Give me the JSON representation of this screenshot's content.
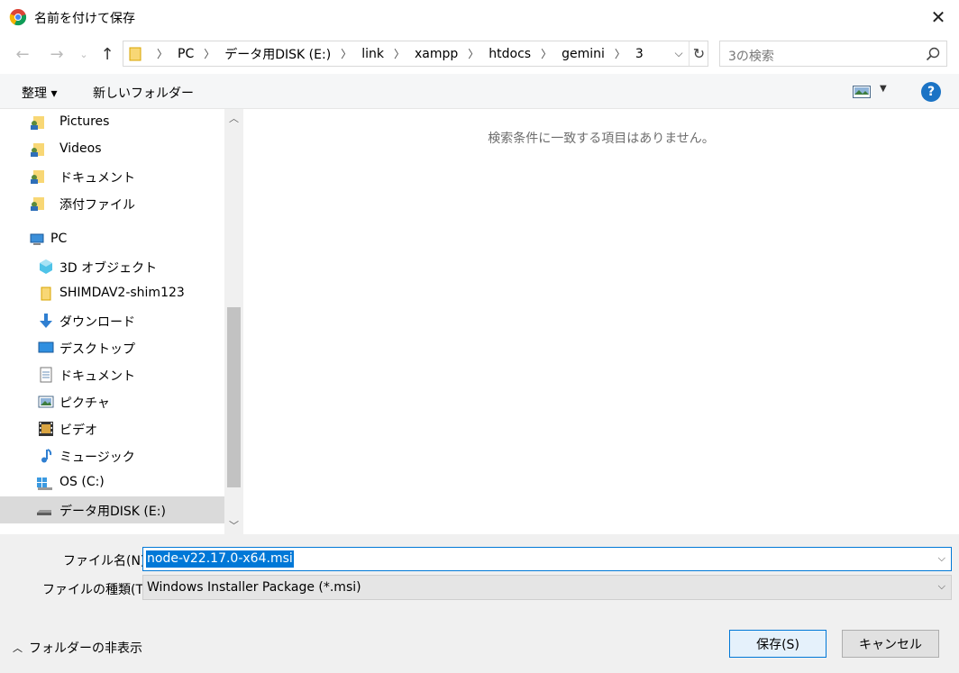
{
  "window": {
    "title": "名前を付けて保存"
  },
  "nav": {
    "breadcrumbs": [
      "PC",
      "データ用DISK (E:)",
      "link",
      "xampp",
      "htdocs",
      "gemini",
      "3"
    ]
  },
  "search": {
    "placeholder": "3の検索"
  },
  "toolbar": {
    "organize": "整理 ▾",
    "new_folder": "新しいフォルダー"
  },
  "sidebar": {
    "items": [
      {
        "label": "Pictures",
        "icon": "user-folder-icon"
      },
      {
        "label": "Videos",
        "icon": "user-folder-icon"
      },
      {
        "label": "ドキュメント",
        "icon": "user-folder-icon"
      },
      {
        "label": "添付ファイル",
        "icon": "user-folder-icon"
      },
      {
        "label": "PC",
        "icon": "pc-icon"
      },
      {
        "label": "3D オブジェクト",
        "icon": "3d-objects-icon"
      },
      {
        "label": "SHIMDAV2-shim123",
        "icon": "folder-icon"
      },
      {
        "label": "ダウンロード",
        "icon": "download-icon"
      },
      {
        "label": "デスクトップ",
        "icon": "desktop-icon"
      },
      {
        "label": "ドキュメント",
        "icon": "document-icon"
      },
      {
        "label": "ピクチャ",
        "icon": "pictures-icon"
      },
      {
        "label": "ビデオ",
        "icon": "video-icon"
      },
      {
        "label": "ミュージック",
        "icon": "music-icon"
      },
      {
        "label": "OS (C:)",
        "icon": "windows-drive-icon"
      },
      {
        "label": "データ用DISK (E:)",
        "icon": "drive-icon"
      }
    ],
    "selected": "データ用DISK (E:)"
  },
  "content": {
    "empty_message": "検索条件に一致する項目はありません。"
  },
  "form": {
    "filename_label": "ファイル名(N):",
    "filename_value": "node-v22.17.0-x64.msi",
    "filetype_label": "ファイルの種類(T):",
    "filetype_value": "Windows Installer Package (*.msi)"
  },
  "footer": {
    "hide_folders": "フォルダーの非表示",
    "save_button": "保存(S)",
    "cancel_button": "キャンセル"
  }
}
